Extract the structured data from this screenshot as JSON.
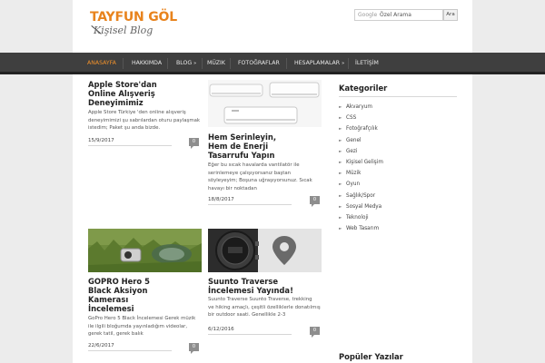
{
  "header": {
    "site_title": "TAYFUN GÖL",
    "tagline": "Kişisel Blog",
    "search": {
      "brand": "Google",
      "placeholder": "Özel Arama",
      "button_label": "Ara"
    }
  },
  "nav": {
    "items": [
      {
        "label": "ANASAYFA",
        "active": true,
        "has_submenu": false
      },
      {
        "label": "HAKKIMDA",
        "active": false,
        "has_submenu": false
      },
      {
        "label": "BLOG",
        "active": false,
        "has_submenu": true
      },
      {
        "label": "MÜZIK",
        "active": false,
        "has_submenu": false
      },
      {
        "label": "FOTOĞRAFLAR",
        "active": false,
        "has_submenu": false
      },
      {
        "label": "HESAPLAMALAR",
        "active": false,
        "has_submenu": true
      },
      {
        "label": "İLETİŞİM",
        "active": false,
        "has_submenu": false
      }
    ],
    "submenu_arrow": "»"
  },
  "posts": [
    {
      "title_lines": [
        "Apple Store'dan",
        "Online Alışveriş",
        "Deneyimimiz"
      ],
      "excerpt_lines": [
        "Apple Store Türkiye 'den online alışveriş",
        "deneyimimizi şu sabrılardan oturu paylaşmak",
        "istedim; Paket şu anda bizde."
      ],
      "date": "15/9/2017",
      "comments": "0"
    },
    {
      "title_lines": [
        "Hem Serinleyin,",
        "Hem de Enerji",
        "Tasarrufu Yapın"
      ],
      "excerpt_lines": [
        "Eğer bu sıcak havalarda vantilatör ile",
        "serinlemeye çalışıyorsanız baştan",
        "söyleyeyim; Boşuna uğraşıyorsunuz. Sıcak",
        "havayı bir noktadan"
      ],
      "date": "18/8/2017",
      "comments": "0"
    },
    {
      "title_lines": [
        "GOPRO Hero 5",
        "Black Aksiyon",
        "Kamerası",
        "İncelemesi"
      ],
      "excerpt_lines": [
        "GoPro Hero 5 Black İncelemesi Gerek müzik",
        "ile ilgili bloğumda yayınladığım videolar,",
        "gerek tatil, gerek balık"
      ],
      "date": "22/6/2017",
      "comments": "0"
    },
    {
      "title_lines": [
        "Suunto Traverse",
        "İncelemesi Yayında!"
      ],
      "excerpt_lines": [
        "Suunto Traverse Suunto Traverse, trekking",
        "ve hiking amaçlı, çeşitli özelliklerle donatılmış",
        "bir outdoor saati. Genellikle 2-3"
      ],
      "date": "6/12/2016",
      "comments": "0"
    }
  ],
  "sidebar": {
    "categories_title": "Kategoriler",
    "categories": [
      "Akvaryum",
      "CSS",
      "Fotoğrafçılık",
      "Genel",
      "Gezi",
      "Kişisel Gelişim",
      "Müzik",
      "Oyun",
      "Sağlık/Spor",
      "Sosyal Medya",
      "Teknoloji",
      "Web Tasarım"
    ],
    "popular_title": "Popüler Yazılar"
  },
  "colors": {
    "accent": "#e8831d",
    "nav_bg": "#3f3f3f",
    "badge": "#8e8e8e"
  },
  "icons": {
    "list_bullet": "chevron-right-icon",
    "comment": "comment-bubble-icon",
    "map_pin": "map-pin-icon"
  }
}
